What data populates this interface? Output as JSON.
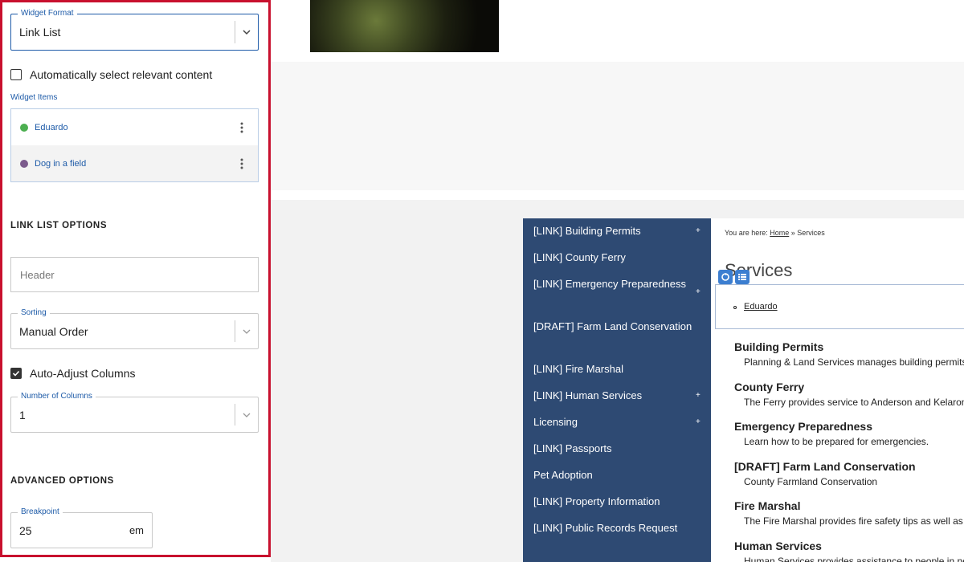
{
  "panel": {
    "widget_format": {
      "legend": "Widget Format",
      "value": "Link List"
    },
    "auto_select": {
      "label": "Automatically select relevant content",
      "checked": false
    },
    "widget_items": {
      "heading": "Widget Items",
      "items": [
        {
          "label": "Eduardo",
          "dot_color": "#4caf50"
        },
        {
          "label": "Dog in a field",
          "dot_color": "#7b5a8c"
        }
      ]
    },
    "link_list_options": {
      "title": "LINK LIST OPTIONS",
      "header_placeholder": "Header",
      "sorting": {
        "legend": "Sorting",
        "value": "Manual Order"
      },
      "auto_adjust": {
        "label": "Auto-Adjust Columns",
        "checked": true
      },
      "columns": {
        "legend": "Number of Columns",
        "value": "1"
      }
    },
    "advanced_options": {
      "title": "ADVANCED OPTIONS",
      "breakpoint": {
        "legend": "Breakpoint",
        "value": "25",
        "unit": "em"
      }
    }
  },
  "preview": {
    "nav": [
      {
        "label": "[LINK] Building Permits",
        "plus": "+"
      },
      {
        "label": "[LINK] County Ferry",
        "plus": ""
      },
      {
        "label": "[LINK] Emergency Preparedness",
        "plus": "+"
      },
      {
        "label": "[DRAFT] Farm Land Conservation",
        "plus": ""
      },
      {
        "label": "[LINK] Fire Marshal",
        "plus": ""
      },
      {
        "label": "[LINK] Human Services",
        "plus": "+"
      },
      {
        "label": "Licensing",
        "plus": "+"
      },
      {
        "label": "[LINK] Passports",
        "plus": ""
      },
      {
        "label": "Pet Adoption",
        "plus": ""
      },
      {
        "label": "[LINK] Property Information",
        "plus": ""
      },
      {
        "label": "[LINK] Public Records Request",
        "plus": ""
      }
    ],
    "breadcrumb": {
      "prefix": "You are here:",
      "home": "Home",
      "sep": "»",
      "current": "Services"
    },
    "page_title": "Services",
    "widget_link": "Eduardo",
    "services": [
      {
        "title": "Building Permits",
        "desc": "Planning & Land Services manages building permits in"
      },
      {
        "title": "County Ferry",
        "desc": "The Ferry provides service to Anderson and Kelaron Is"
      },
      {
        "title": "Emergency Preparedness",
        "desc": "Learn how to be prepared for emergencies."
      },
      {
        "title": "[DRAFT] Farm Land Conservation",
        "desc": "County Farmland Conservation"
      },
      {
        "title": "Fire Marshal",
        "desc": "The Fire Marshal provides fire safety tips as well as pe"
      },
      {
        "title": "Human Services",
        "desc": "Human Services provides assistance to people in need"
      }
    ]
  },
  "colors": {
    "panel_border": "#c8102e",
    "accent": "#1e5ba8",
    "nav_bg": "#2e4a73"
  }
}
